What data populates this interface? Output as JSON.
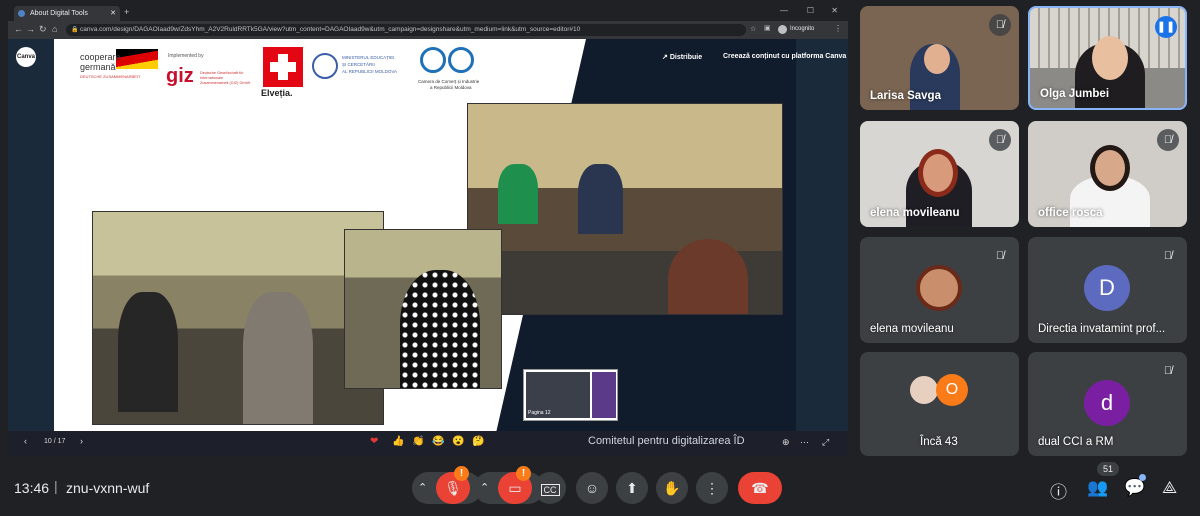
{
  "browser": {
    "tab_title": "About Digital Tools",
    "url": "canva.com/design/DAGAOIaad9w/ZdsYhm_A2V2RuldRRTk5GA/view?utm_content=DAGAOIaad9w&utm_campaign=designshare&utm_medium=link&utm_source=editor#10",
    "incognito_label": "Incognito"
  },
  "canva": {
    "logo": "Canva",
    "share_label": "Distribuie",
    "create_label": "Creează conținut cu platforma Canva",
    "page_indicator": "10 / 17",
    "thumb_label": "Pagina 12",
    "caption": "Comitetul pentru digitalizarea ÎD",
    "progress": 0.62,
    "reactions": [
      "❤",
      "👍",
      "👏",
      "😂",
      "😮",
      "🤔"
    ]
  },
  "slide": {
    "logo1_line1": "cooperare",
    "logo1_line2": "germană",
    "logo1_line3": "DEUTSCHE ZUSAMMENARBEIT",
    "logo2_pre": "Implemented by",
    "logo2_name": "giz",
    "logo2_sub": "Deutsche Gesellschaft für Internationale Zusammenarbeit (GIZ) GmbH",
    "logo3": "Elveția.",
    "logo4_line1": "MINISTERUL EDUCAȚIEI",
    "logo4_line2": "ȘI CERCETĂRII",
    "logo4_line3": "AL REPUBLICII MOLDOVA",
    "logo5_line1": "Camera de Comerț și Industrie",
    "logo5_line2": "a Republicii Moldova"
  },
  "participants": [
    {
      "name": "Larisa Savga",
      "muted": true
    },
    {
      "name": "Olga Jumbei",
      "muted": false,
      "speaking": true
    },
    {
      "name": "elena movileanu",
      "muted": true
    },
    {
      "name": "office rosca",
      "muted": true
    },
    {
      "name": "elena movileanu",
      "muted": true
    },
    {
      "name": "Directia invatamint prof...",
      "muted": true,
      "initial": "D"
    },
    {
      "name": "Încă 43",
      "extra_initial": "O"
    },
    {
      "name": "dual CCI a RM",
      "muted": true,
      "initial": "d"
    }
  ],
  "bottom": {
    "time": "13:46",
    "meeting_code": "znu-vxnn-wuf",
    "people_count": "51",
    "alert_badge": "!"
  },
  "colors": {
    "accent": "#8ab4f8",
    "end_call": "#ea4335",
    "badge": "#fa7b17",
    "avatar_d": "#5c6bc0",
    "avatar_dual": "#7b1fa2"
  }
}
